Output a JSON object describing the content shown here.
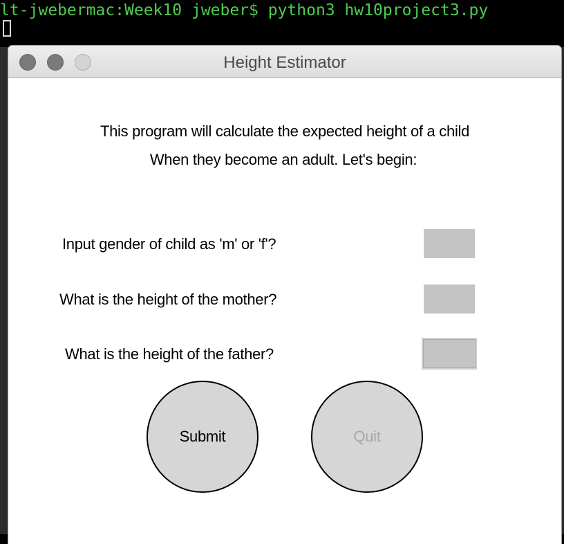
{
  "terminal": {
    "prompt_line": "lt-jwebermac:Week10 jweber$ python3 hw10project3.py"
  },
  "window": {
    "title": "Height Estimator"
  },
  "intro": {
    "line1": "This program will calculate the expected height of a child",
    "line2": "When they become an adult. Let's begin:"
  },
  "form": {
    "gender_label": "Input gender of child as 'm' or 'f'?",
    "gender_value": "",
    "mother_label": "What is the height of the mother?",
    "mother_value": "",
    "father_label": "What is the height of the father?",
    "father_value": ""
  },
  "buttons": {
    "submit_label": "Submit",
    "quit_label": "Quit"
  },
  "colors": {
    "terminal_text": "#4ecb4e",
    "entry_background": "#c4c4c4",
    "button_background": "#d6d6d6",
    "disabled_text": "#a8a8a8"
  }
}
